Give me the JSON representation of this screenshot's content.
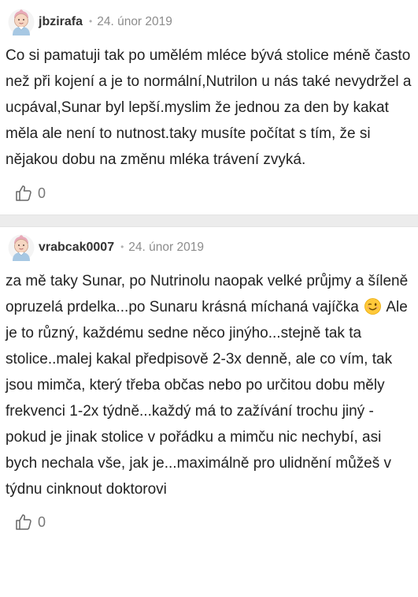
{
  "comments": [
    {
      "author": "jbzirafa",
      "separator": "•",
      "date": "24. únor 2019",
      "text": "Co si pamatuji tak po umělém mléce bývá stolice méně často než při kojení a je to normální,Nutrilon u nás také nevydržel a ucpával,Sunar byl lepší.myslim že jednou za den by kakat měla ale není to nutnost.taky musíte počítat s tím, že si nějakou dobu na změnu mléka trávení zvyká.",
      "likes": "0"
    },
    {
      "author": "vrabcak0007",
      "separator": "•",
      "date": "24. únor 2019",
      "text_before_emoji": "za mě taky Sunar, po Nutrinolu naopak velké průjmy a šíleně opruzelá prdelka...po Sunaru krásná míchaná vajíčka",
      "emoji": "winking-face",
      "text_after_emoji": " Ale je to různý, každému sedne něco jinýho...stejně tak ta stolice..malej kakal předpisově 2-3x denně, ale co vím, tak jsou mimča, který třeba občas nebo po určitou dobu měly frekvenci 1-2x týdně...každý má to zažívání trochu jiný - pokud je jinak stolice v pořádku a mimču nic nechybí, asi bych nechala vše, jak je...maximálně pro ulidnění můžeš v týdnu cinknout doktorovi",
      "likes": "0"
    }
  ],
  "icons": {
    "avatar": "baby-avatar-icon",
    "like": "thumbs-up-icon"
  },
  "colors": {
    "separator_bg": "#ececec",
    "date": "#8c8c8c",
    "avatar_skin": "#f6d6c2",
    "avatar_bow": "#e8a9b8"
  }
}
